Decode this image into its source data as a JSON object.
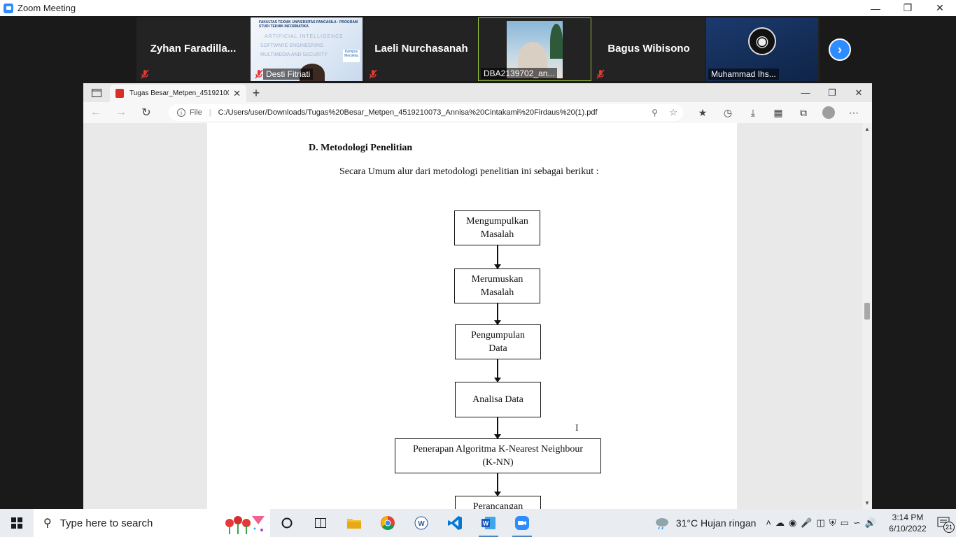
{
  "zoom": {
    "title": "Zoom Meeting",
    "participants": [
      {
        "name": "Zyhan  Faradilla...",
        "muted": true
      },
      {
        "label": "Desti Fitriati",
        "muted": true,
        "slide_header": "FAKULTAS TEKNIK UNIVERSITAS PANCASILA · PROGRAM STUDI TEKNIK INFORMATIKA",
        "slide_lines": [
          "ARTIFICIAL INTELLIGENCE",
          "SOFTWARE ENGINEERING",
          "MULTIMEDIA AND SECURITY"
        ],
        "slide_badge": "Kampus Merdeka"
      },
      {
        "name": "Laeli Nurchasanah",
        "muted": true
      },
      {
        "label": "DBA2139702_an..."
      },
      {
        "name": "Bagus Wibisono",
        "muted": true
      },
      {
        "label": "Muhammad Ihs..."
      }
    ]
  },
  "browser": {
    "tab_title": "Tugas Besar_Metpen_451921007",
    "url_scheme": "File",
    "url": "C:/Users/user/Downloads/Tugas%20Besar_Metpen_4519210073_Annisa%20Cintakami%20Firdaus%20(1).pdf"
  },
  "document": {
    "heading": "D. Metodologi Penelitian",
    "intro": "Secara Umum alur dari metodologi penelitian ini sebagai berikut :",
    "flow": [
      {
        "line1": "Mengumpulkan",
        "line2": "Masalah"
      },
      {
        "line1": "Merumuskan",
        "line2": "Masalah"
      },
      {
        "line1": "Pengumpulan",
        "line2": "Data"
      },
      {
        "line1": "Analisa Data",
        "line2": ""
      },
      {
        "line1": "Penerapan Algoritma K-Nearest Neighbour",
        "line2": "(K-NN)"
      },
      {
        "line1": "Perancangan",
        "line2": ""
      }
    ]
  },
  "taskbar": {
    "search_placeholder": "Type here to search",
    "weather": "31°C  Hujan ringan",
    "time": "3:14 PM",
    "date": "6/10/2022",
    "notifications": "21"
  }
}
